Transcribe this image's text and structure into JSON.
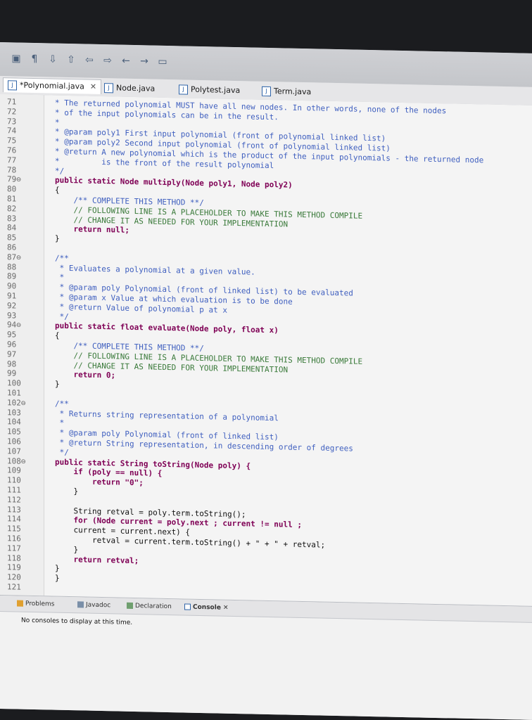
{
  "toolbar": {
    "icons": [
      "save-icon",
      "pilcrow-icon",
      "download-icon",
      "upload-icon",
      "back-icon",
      "forward-icon",
      "back-arrow-icon",
      "forward-arrow-icon",
      "open-icon"
    ]
  },
  "tabs": [
    {
      "label": "*Polynomial.java",
      "active": true,
      "close": "✕"
    },
    {
      "label": "Node.java",
      "active": false
    },
    {
      "label": "Polytest.java",
      "active": false
    },
    {
      "label": "Term.java",
      "active": false
    }
  ],
  "code": [
    {
      "n": "71",
      "t": "* The returned polynomial MUST have all new nodes. In other words, none of the nodes",
      "k": "doc"
    },
    {
      "n": "72",
      "t": "* of the input polynomials can be in the result.",
      "k": "doc"
    },
    {
      "n": "73",
      "t": "*",
      "k": "doc"
    },
    {
      "n": "74",
      "t": "* @param poly1 First input polynomial (front of polynomial linked list)",
      "k": "doc"
    },
    {
      "n": "75",
      "t": "* @param poly2 Second input polynomial (front of polynomial linked list)",
      "k": "doc"
    },
    {
      "n": "76",
      "t": "* @return A new polynomial which is the product of the input polynomials - the returned node",
      "k": "doc"
    },
    {
      "n": "77",
      "t": "*         is the front of the result polynomial",
      "k": "doc"
    },
    {
      "n": "78",
      "t": "*/",
      "k": "doc"
    },
    {
      "n": "79⊖",
      "t": "public static Node multiply(Node poly1, Node poly2)",
      "k": "kw"
    },
    {
      "n": "80",
      "t": "{",
      "k": "plain"
    },
    {
      "n": "81",
      "t": "    /** COMPLETE THIS METHOD **/",
      "k": "doc"
    },
    {
      "n": "82",
      "t": "    // FOLLOWING LINE IS A PLACEHOLDER TO MAKE THIS METHOD COMPILE",
      "k": "cmt"
    },
    {
      "n": "83",
      "t": "    // CHANGE IT AS NEEDED FOR YOUR IMPLEMENTATION",
      "k": "cmt"
    },
    {
      "n": "84",
      "t": "    return null;",
      "k": "kw"
    },
    {
      "n": "85",
      "t": "}",
      "k": "plain"
    },
    {
      "n": "86",
      "t": "",
      "k": "plain"
    },
    {
      "n": "87⊖",
      "t": "/**",
      "k": "doc"
    },
    {
      "n": "88",
      "t": " * Evaluates a polynomial at a given value.",
      "k": "doc"
    },
    {
      "n": "89",
      "t": " *",
      "k": "doc"
    },
    {
      "n": "90",
      "t": " * @param poly Polynomial (front of linked list) to be evaluated",
      "k": "doc"
    },
    {
      "n": "91",
      "t": " * @param x Value at which evaluation is to be done",
      "k": "doc"
    },
    {
      "n": "92",
      "t": " * @return Value of polynomial p at x",
      "k": "doc"
    },
    {
      "n": "93",
      "t": " */",
      "k": "doc"
    },
    {
      "n": "94⊖",
      "t": "public static float evaluate(Node poly, float x)",
      "k": "kw"
    },
    {
      "n": "95",
      "t": "{",
      "k": "plain"
    },
    {
      "n": "96",
      "t": "    /** COMPLETE THIS METHOD **/",
      "k": "doc"
    },
    {
      "n": "97",
      "t": "    // FOLLOWING LINE IS A PLACEHOLDER TO MAKE THIS METHOD COMPILE",
      "k": "cmt"
    },
    {
      "n": "98",
      "t": "    // CHANGE IT AS NEEDED FOR YOUR IMPLEMENTATION",
      "k": "cmt"
    },
    {
      "n": "99",
      "t": "    return 0;",
      "k": "kw"
    },
    {
      "n": "100",
      "t": "}",
      "k": "plain"
    },
    {
      "n": "101",
      "t": "",
      "k": "plain"
    },
    {
      "n": "102⊖",
      "t": "/**",
      "k": "doc"
    },
    {
      "n": "103",
      "t": " * Returns string representation of a polynomial",
      "k": "doc"
    },
    {
      "n": "104",
      "t": " *",
      "k": "doc"
    },
    {
      "n": "105",
      "t": " * @param poly Polynomial (front of linked list)",
      "k": "doc"
    },
    {
      "n": "106",
      "t": " * @return String representation, in descending order of degrees",
      "k": "doc"
    },
    {
      "n": "107",
      "t": " */",
      "k": "doc"
    },
    {
      "n": "108⊖",
      "t": "public static String toString(Node poly) {",
      "k": "kw"
    },
    {
      "n": "109",
      "t": "    if (poly == null) {",
      "k": "kw"
    },
    {
      "n": "110",
      "t": "        return \"0\";",
      "k": "kw"
    },
    {
      "n": "111",
      "t": "    }",
      "k": "plain"
    },
    {
      "n": "112",
      "t": "",
      "k": "plain"
    },
    {
      "n": "113",
      "t": "    String retval = poly.term.toString();",
      "k": "plain"
    },
    {
      "n": "114",
      "t": "    for (Node current = poly.next ; current != null ;",
      "k": "kw"
    },
    {
      "n": "115",
      "t": "    current = current.next) {",
      "k": "plain"
    },
    {
      "n": "116",
      "t": "        retval = current.term.toString() + \" + \" + retval;",
      "k": "plain"
    },
    {
      "n": "117",
      "t": "    }",
      "k": "plain"
    },
    {
      "n": "118",
      "t": "    return retval;",
      "k": "kw"
    },
    {
      "n": "119",
      "t": "}",
      "k": "plain"
    },
    {
      "n": "120",
      "t": "}",
      "k": "plain"
    },
    {
      "n": "121",
      "t": "",
      "k": "plain"
    }
  ],
  "bottom_panel": {
    "tabs": [
      "Problems",
      "Javadoc",
      "Declaration",
      "Console ✕"
    ],
    "message": "No consoles to display at this time."
  },
  "colors": {
    "doc": "#3f5fbf",
    "comment": "#3a7a3a",
    "keyword": "#7f0055"
  }
}
